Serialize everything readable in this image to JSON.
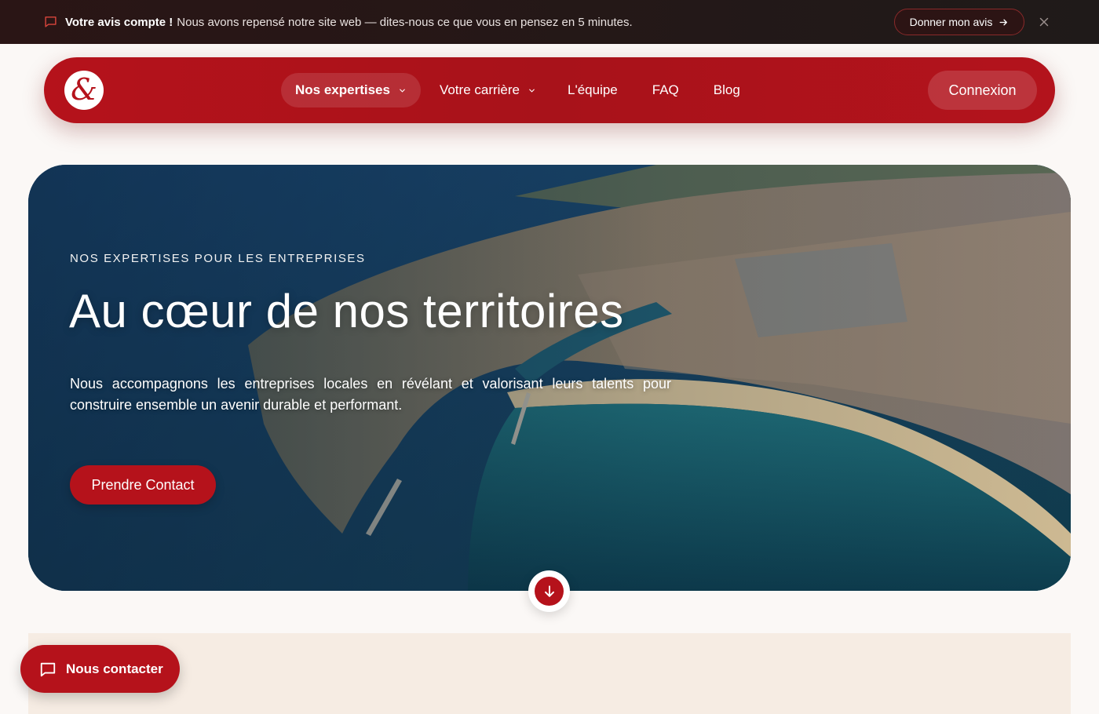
{
  "announcement": {
    "bold": "Votre avis compte !",
    "text": "Nous avons repensé notre site web — dites-nous ce que vous en pensez en 5 minutes.",
    "cta_label": "Donner mon avis",
    "icon": "message-square-icon",
    "close_icon": "close-icon"
  },
  "nav": {
    "logo_glyph": "&",
    "items": [
      {
        "label": "Nos expertises",
        "has_dropdown": true,
        "active": true
      },
      {
        "label": "Votre carrière",
        "has_dropdown": true,
        "active": false
      },
      {
        "label": "L'équipe",
        "has_dropdown": false,
        "active": false
      },
      {
        "label": "FAQ",
        "has_dropdown": false,
        "active": false
      },
      {
        "label": "Blog",
        "has_dropdown": false,
        "active": false
      }
    ],
    "login_label": "Connexion"
  },
  "hero": {
    "eyebrow": "NOS EXPERTISES POUR LES ENTREPRISES",
    "title": "Au cœur de nos territoires",
    "description": "Nous accompagnons les entreprises locales en révélant et valorisant leurs talents pour construire ensemble un avenir durable et performant.",
    "cta_label": "Prendre Contact",
    "scroll_icon": "arrow-down-icon"
  },
  "floating_contact": {
    "label": "Nous contacter",
    "icon": "message-square-icon"
  },
  "colors": {
    "brand_red": "#b5121b",
    "announce_bg": "#2a1515",
    "beige": "#f6ece3"
  }
}
